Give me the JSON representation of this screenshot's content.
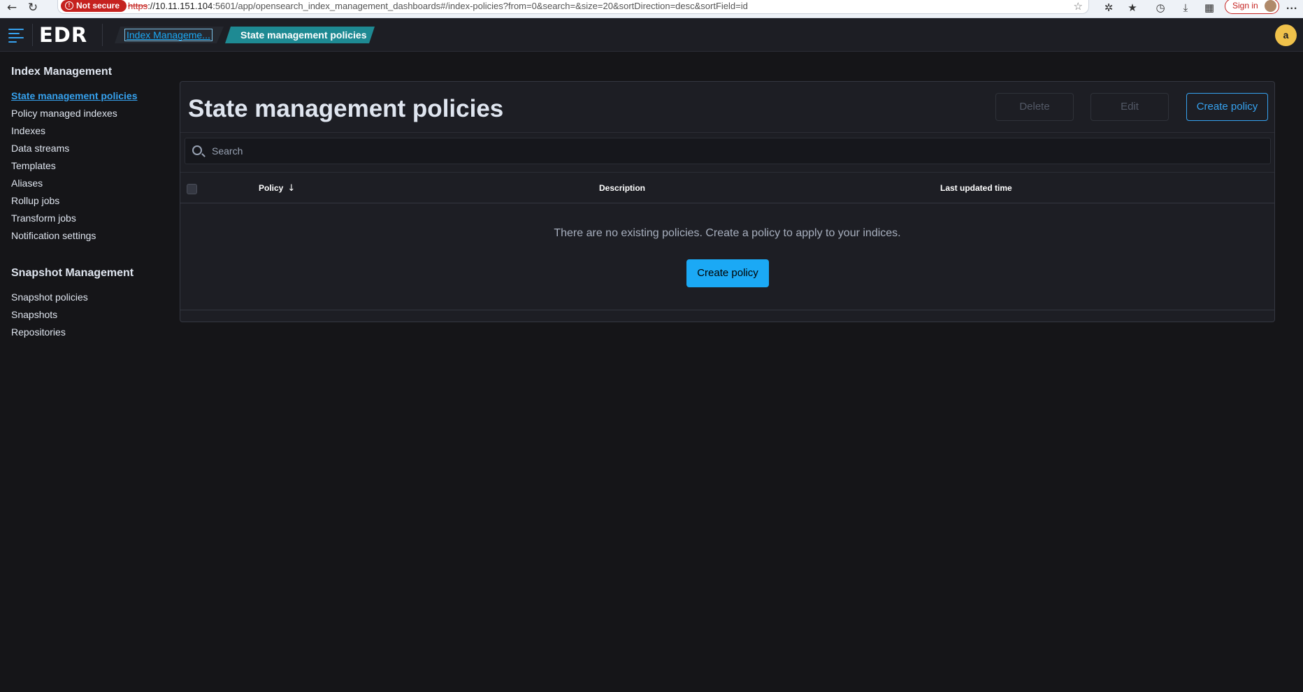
{
  "browser": {
    "not_secure_label": "Not secure",
    "url_proto": "https",
    "url_host": "://10.11.151.104",
    "url_rest": ":5601/app/opensearch_index_management_dashboards#/index-policies?from=0&search=&size=20&sortDirection=desc&sortField=id",
    "signin_label": "Sign in",
    "more_label": "..."
  },
  "header": {
    "logo": "EDR",
    "breadcrumbs": [
      "Index Manageme...",
      "State management policies"
    ],
    "user_initial": "a"
  },
  "sidebar": {
    "sections": [
      {
        "heading": "Index Management",
        "items": [
          "State management policies",
          "Policy managed indexes",
          "Indexes",
          "Data streams",
          "Templates",
          "Aliases",
          "Rollup jobs",
          "Transform jobs",
          "Notification settings"
        ]
      },
      {
        "heading": "Snapshot Management",
        "items": [
          "Snapshot policies",
          "Snapshots",
          "Repositories"
        ]
      }
    ],
    "active_item": "State management policies"
  },
  "main": {
    "title": "State management policies",
    "buttons": {
      "delete": "Delete",
      "edit": "Edit",
      "create": "Create policy"
    },
    "search": {
      "placeholder": "Search",
      "value": ""
    },
    "table": {
      "columns": [
        "Policy",
        "Description",
        "Last updated time"
      ],
      "sort_icon": "↓",
      "empty_message": "There are no existing policies. Create a policy to apply to your indices.",
      "empty_action": "Create policy"
    }
  },
  "colors": {
    "accent": "#36a2ef",
    "primary_button": "#1ba9f5",
    "active_crumb": "#1e8a93",
    "avatar": "#f0c24b"
  }
}
